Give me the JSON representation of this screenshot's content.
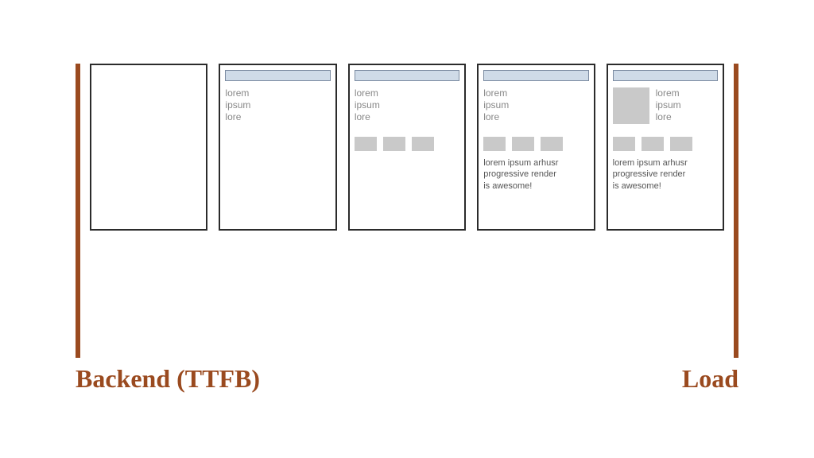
{
  "labels": {
    "left": "Backend (TTFB)",
    "right": "Load"
  },
  "placeholder": {
    "hero_text": "lorem\nipsum\nlore",
    "body_text": "lorem ipsum arhusr\nprogressive render\nis awesome!"
  },
  "frames": [
    {
      "topbar": false,
      "hero_text": false,
      "hero_img": false,
      "thumbs": false,
      "body": false
    },
    {
      "topbar": true,
      "hero_text": true,
      "hero_img": false,
      "thumbs": false,
      "body": false
    },
    {
      "topbar": true,
      "hero_text": true,
      "hero_img": false,
      "thumbs": true,
      "body": false
    },
    {
      "topbar": true,
      "hero_text": true,
      "hero_img": false,
      "thumbs": true,
      "body": true
    },
    {
      "topbar": true,
      "hero_text": true,
      "hero_img": true,
      "thumbs": true,
      "body": true
    }
  ],
  "colors": {
    "accent": "#9a4a1f",
    "topbar_fill": "#cfdbe8",
    "topbar_border": "#7a8aa0",
    "placeholder_block": "#c9c9c9"
  }
}
